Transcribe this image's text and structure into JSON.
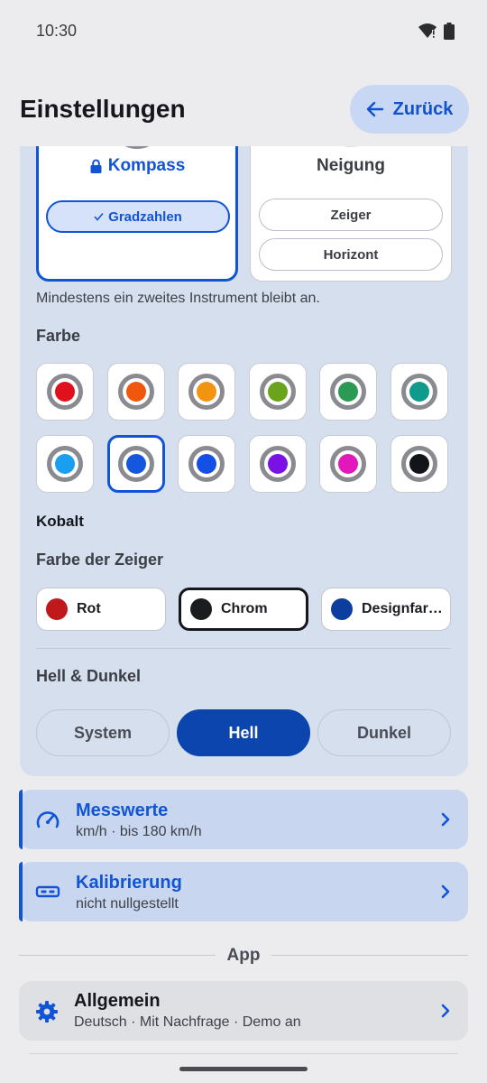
{
  "status": {
    "time": "10:30"
  },
  "header": {
    "title": "Einstellungen",
    "back_label": "Zurück"
  },
  "instruments": {
    "compass": {
      "name": "Kompass",
      "options": [
        "Gradzahlen"
      ]
    },
    "tilt": {
      "name": "Neigung",
      "options": [
        "Zeiger",
        "Horizont"
      ]
    },
    "hint": "Mindestens ein zweites Instrument bleibt an."
  },
  "color": {
    "label": "Farbe",
    "selected_name": "Kobalt",
    "swatches": [
      "#e0101c",
      "#f0570d",
      "#f2940f",
      "#6aa31c",
      "#2a9a54",
      "#0f9a8c",
      "#1a9ef0",
      "#1457de",
      "#1450e6",
      "#7a12e6",
      "#e318ba",
      "#111418"
    ]
  },
  "hands": {
    "label": "Farbe der Zeiger",
    "options": [
      {
        "label": "Rot",
        "color": "#c0191c"
      },
      {
        "label": "Chrom",
        "color": "#1a1c1e"
      },
      {
        "label": "Designfar…",
        "color": "#0b3e9e"
      }
    ]
  },
  "theme": {
    "label": "Hell & Dunkel",
    "options": [
      "System",
      "Hell",
      "Dunkel"
    ],
    "active": "Hell"
  },
  "nav": {
    "measurements": {
      "title": "Messwerte",
      "subtitle": "km/h · bis 180 km/h"
    },
    "calibration": {
      "title": "Kalibrierung",
      "subtitle": "nicht nullgestellt"
    }
  },
  "app_section": {
    "label": "App"
  },
  "general": {
    "title": "Allgemein",
    "subtitle": "Deutsch · Mit Nachfrage · Demo an"
  },
  "colors": {
    "accent": "#1155d6",
    "active_button": "#0c45ad",
    "panel": "#d5dfee"
  }
}
